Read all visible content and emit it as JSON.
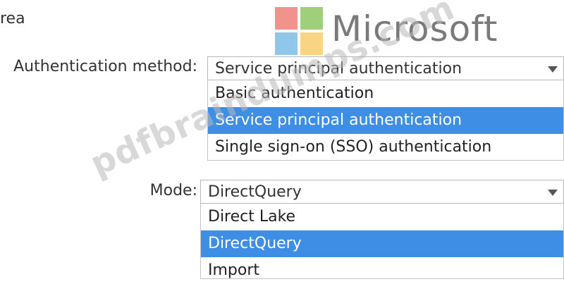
{
  "header": {
    "area_label": "rea"
  },
  "logo": {
    "text": "Microsoft"
  },
  "authentication": {
    "label": "Authentication method:",
    "selected": "Service principal authentication",
    "options": [
      "Basic authentication",
      "Service principal authentication",
      "Single sign-on (SSO) authentication"
    ]
  },
  "mode": {
    "label": "Mode:",
    "selected": "DirectQuery",
    "options": [
      "Direct Lake",
      "DirectQuery",
      "Import"
    ]
  },
  "watermark": {
    "text": "pdfbraindumps.com"
  },
  "colors": {
    "selection": "#3d8ee4"
  }
}
